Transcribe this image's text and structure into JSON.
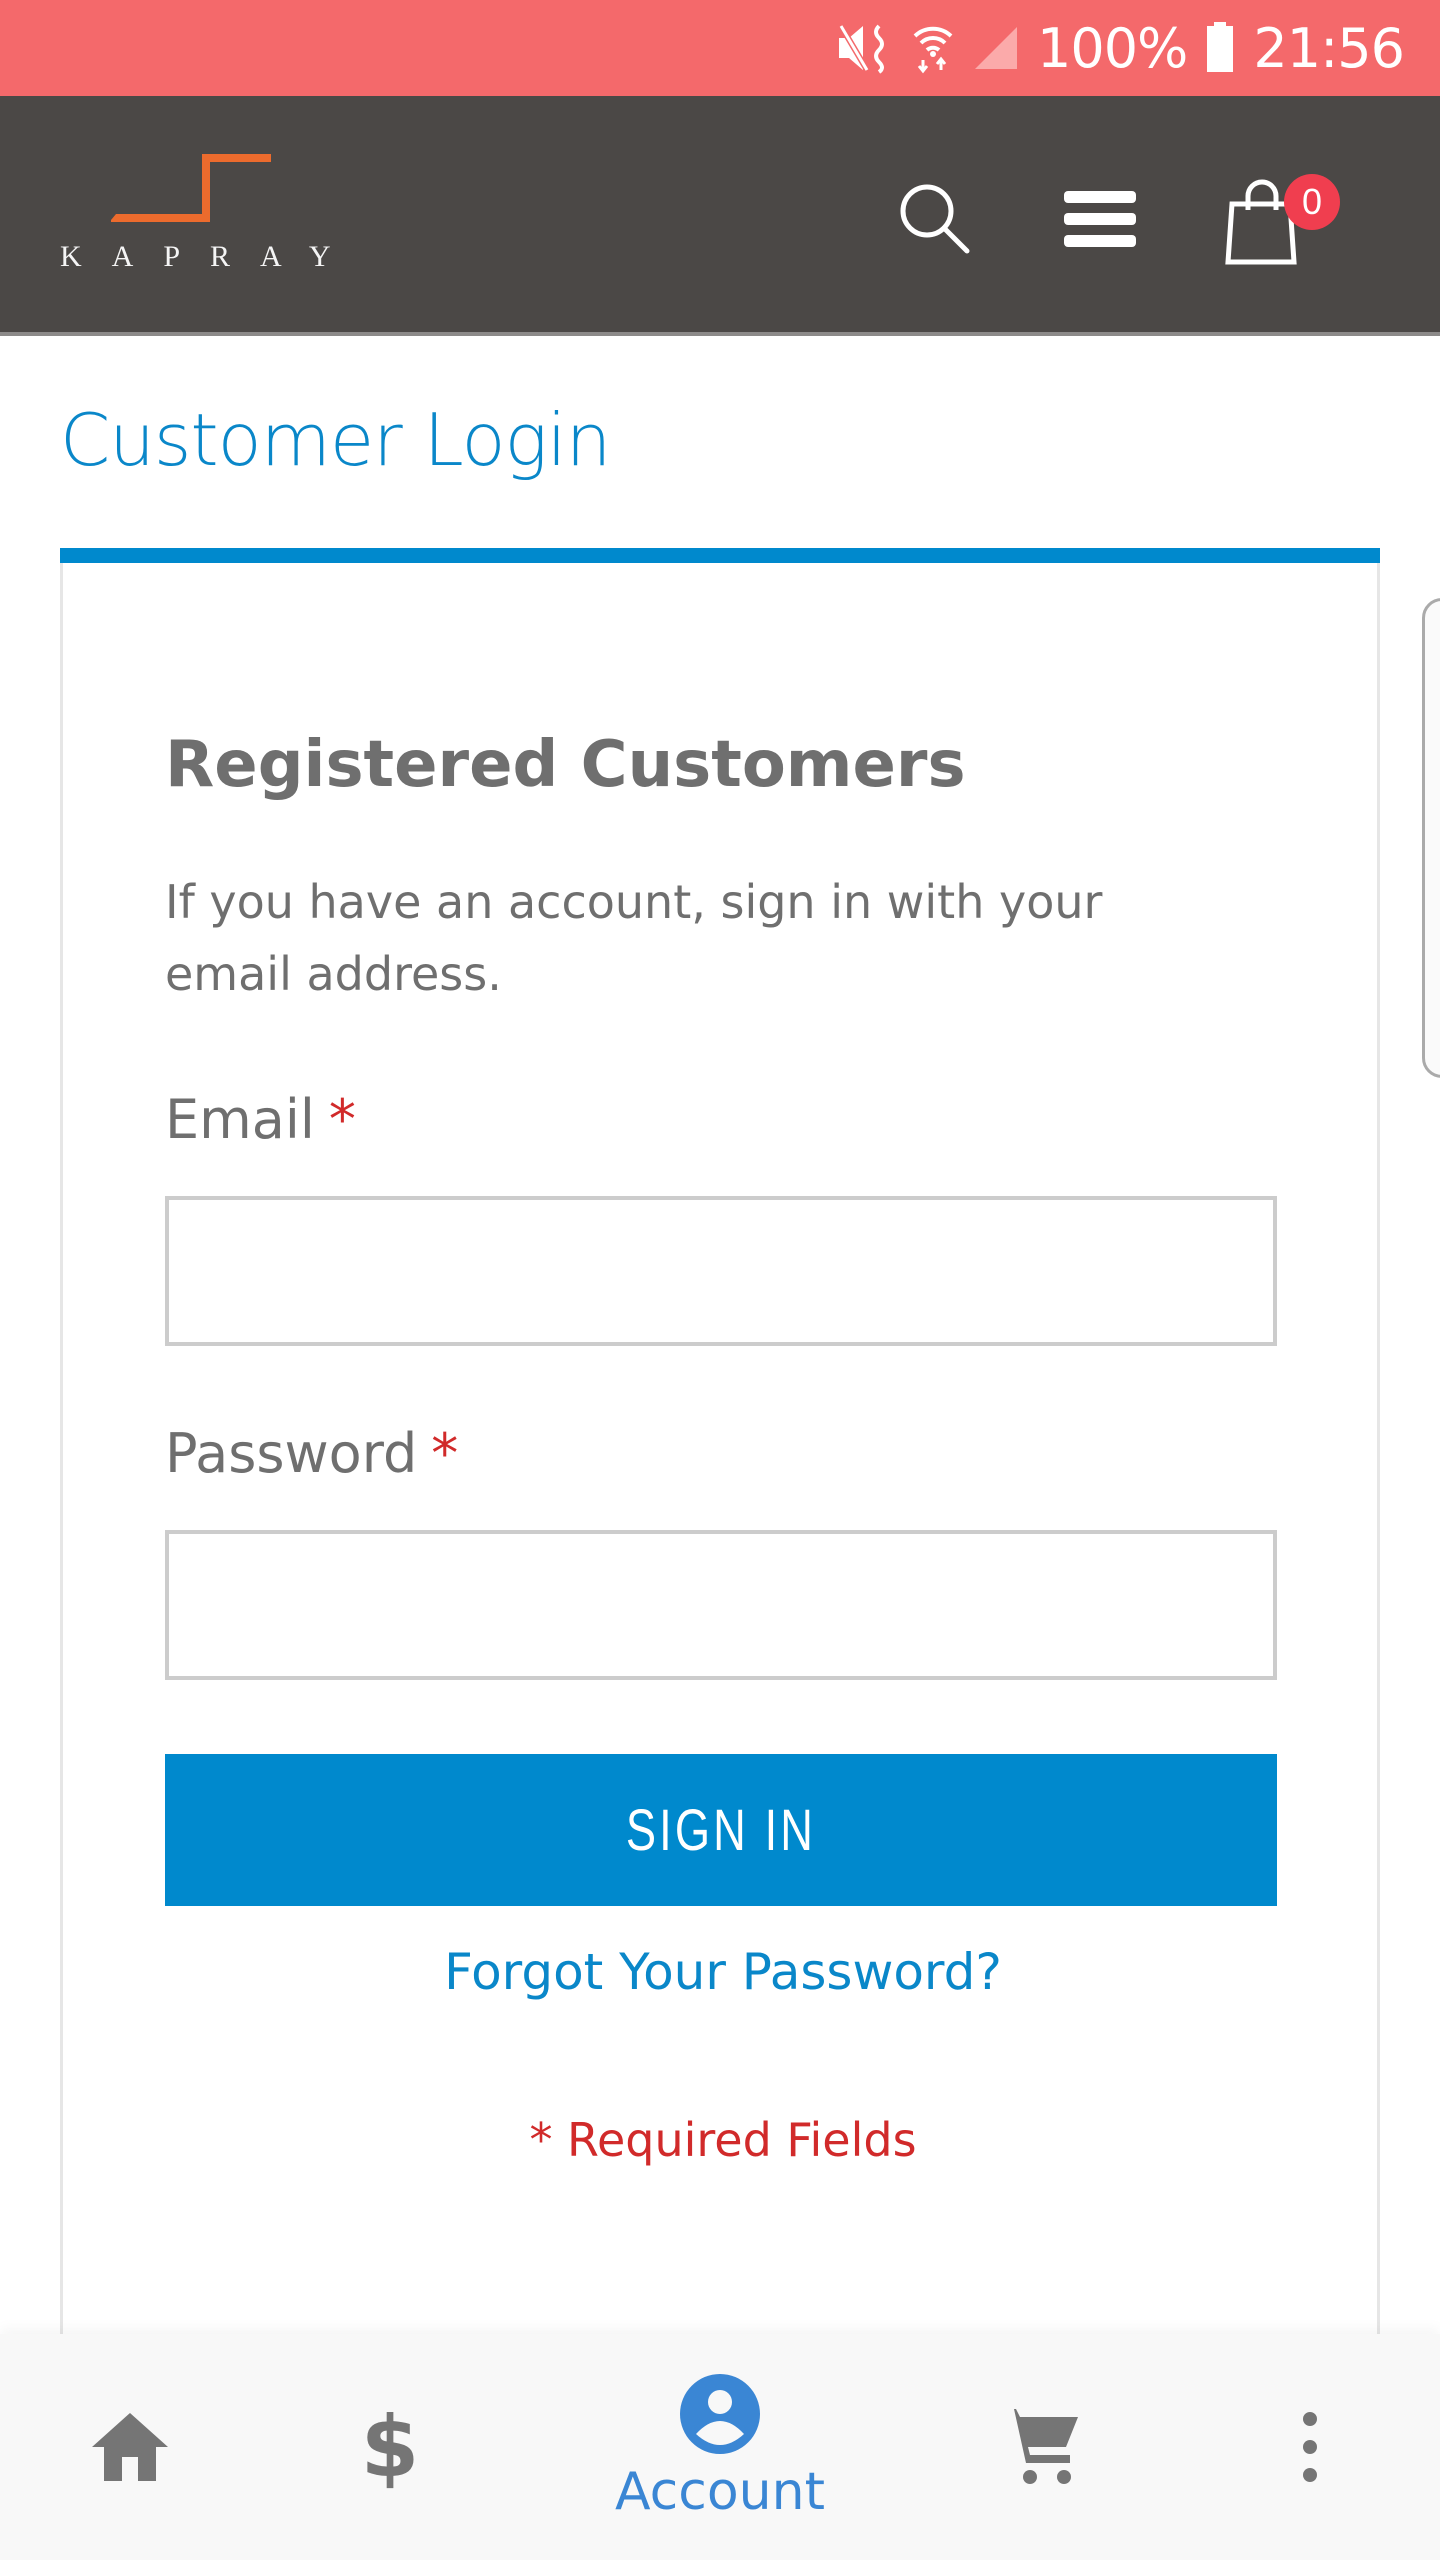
{
  "status_bar": {
    "battery_percent": "100%",
    "time": "21:56",
    "icons": [
      "mute-vibrate-icon",
      "wifi-icon",
      "cell-signal-icon",
      "battery-icon"
    ],
    "background_color": "#f4696b"
  },
  "header": {
    "brand_name": "KAPRAY",
    "cart_count": "0",
    "icons": [
      "search-icon",
      "hamburger-menu-icon",
      "shopping-bag-icon"
    ],
    "background_color": "#4b4846",
    "logo_accent_color": "#ec6b2d",
    "badge_color": "#f03e4f"
  },
  "page": {
    "title": "Customer Login",
    "accent_color": "#0089cd"
  },
  "login_card": {
    "heading": "Registered Customers",
    "description": "If you have an account, sign in with your email address.",
    "email": {
      "label": "Email",
      "required_mark": "*",
      "value": "",
      "placeholder": ""
    },
    "password": {
      "label": "Password",
      "required_mark": "*",
      "value": "",
      "placeholder": ""
    },
    "sign_in_label": "SIGN IN",
    "forgot_password_label": "Forgot Your Password?",
    "required_note": "* Required Fields",
    "required_color": "#d12a2a"
  },
  "bottom_nav": {
    "items": [
      {
        "id": "home",
        "icon": "home-icon",
        "label": "",
        "active": false
      },
      {
        "id": "pricing",
        "icon": "dollar-icon",
        "glyph": "$",
        "label": "",
        "active": false
      },
      {
        "id": "account",
        "icon": "account-circle-icon",
        "label": "Account",
        "active": true
      },
      {
        "id": "cart",
        "icon": "cart-icon",
        "label": "",
        "active": false
      },
      {
        "id": "more",
        "icon": "more-vertical-icon",
        "label": "",
        "active": false
      }
    ],
    "active_color": "#3a86d4",
    "inactive_color": "#757575"
  }
}
